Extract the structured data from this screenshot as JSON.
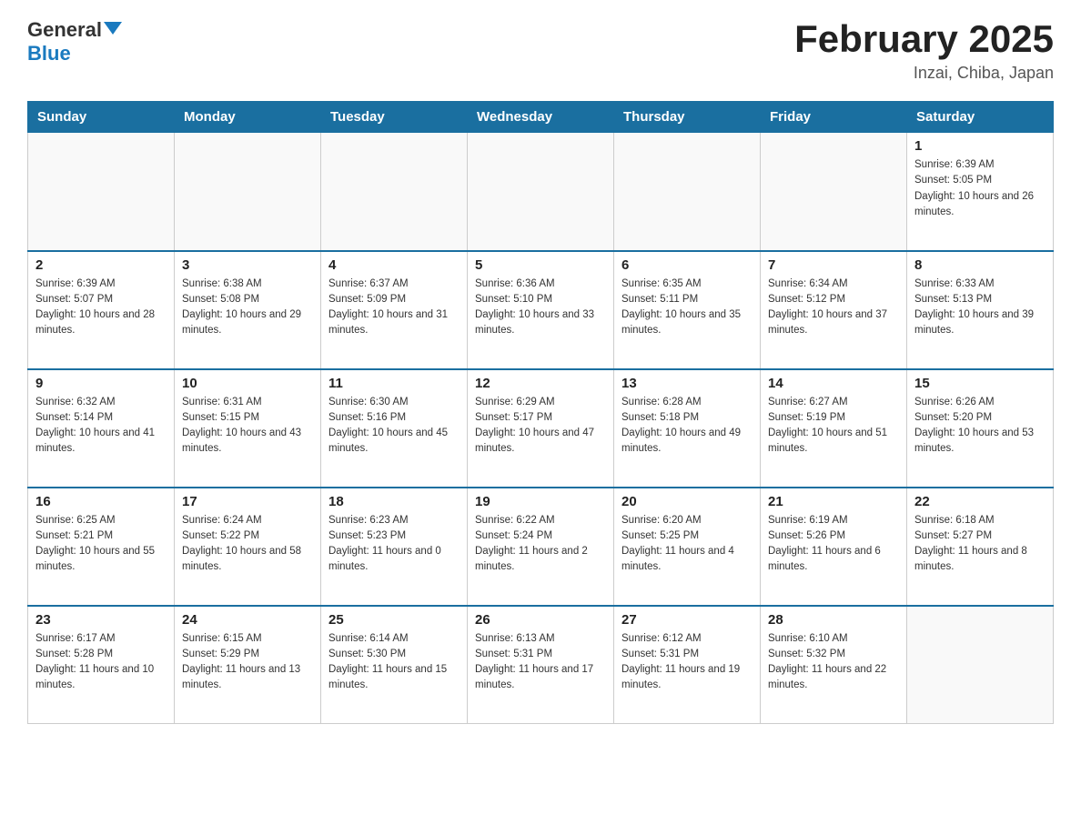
{
  "header": {
    "logo_general": "General",
    "logo_blue": "Blue",
    "title": "February 2025",
    "subtitle": "Inzai, Chiba, Japan"
  },
  "days_of_week": [
    "Sunday",
    "Monday",
    "Tuesday",
    "Wednesday",
    "Thursday",
    "Friday",
    "Saturday"
  ],
  "weeks": [
    [
      {
        "day": "",
        "info": ""
      },
      {
        "day": "",
        "info": ""
      },
      {
        "day": "",
        "info": ""
      },
      {
        "day": "",
        "info": ""
      },
      {
        "day": "",
        "info": ""
      },
      {
        "day": "",
        "info": ""
      },
      {
        "day": "1",
        "info": "Sunrise: 6:39 AM\nSunset: 5:05 PM\nDaylight: 10 hours and 26 minutes."
      }
    ],
    [
      {
        "day": "2",
        "info": "Sunrise: 6:39 AM\nSunset: 5:07 PM\nDaylight: 10 hours and 28 minutes."
      },
      {
        "day": "3",
        "info": "Sunrise: 6:38 AM\nSunset: 5:08 PM\nDaylight: 10 hours and 29 minutes."
      },
      {
        "day": "4",
        "info": "Sunrise: 6:37 AM\nSunset: 5:09 PM\nDaylight: 10 hours and 31 minutes."
      },
      {
        "day": "5",
        "info": "Sunrise: 6:36 AM\nSunset: 5:10 PM\nDaylight: 10 hours and 33 minutes."
      },
      {
        "day": "6",
        "info": "Sunrise: 6:35 AM\nSunset: 5:11 PM\nDaylight: 10 hours and 35 minutes."
      },
      {
        "day": "7",
        "info": "Sunrise: 6:34 AM\nSunset: 5:12 PM\nDaylight: 10 hours and 37 minutes."
      },
      {
        "day": "8",
        "info": "Sunrise: 6:33 AM\nSunset: 5:13 PM\nDaylight: 10 hours and 39 minutes."
      }
    ],
    [
      {
        "day": "9",
        "info": "Sunrise: 6:32 AM\nSunset: 5:14 PM\nDaylight: 10 hours and 41 minutes."
      },
      {
        "day": "10",
        "info": "Sunrise: 6:31 AM\nSunset: 5:15 PM\nDaylight: 10 hours and 43 minutes."
      },
      {
        "day": "11",
        "info": "Sunrise: 6:30 AM\nSunset: 5:16 PM\nDaylight: 10 hours and 45 minutes."
      },
      {
        "day": "12",
        "info": "Sunrise: 6:29 AM\nSunset: 5:17 PM\nDaylight: 10 hours and 47 minutes."
      },
      {
        "day": "13",
        "info": "Sunrise: 6:28 AM\nSunset: 5:18 PM\nDaylight: 10 hours and 49 minutes."
      },
      {
        "day": "14",
        "info": "Sunrise: 6:27 AM\nSunset: 5:19 PM\nDaylight: 10 hours and 51 minutes."
      },
      {
        "day": "15",
        "info": "Sunrise: 6:26 AM\nSunset: 5:20 PM\nDaylight: 10 hours and 53 minutes."
      }
    ],
    [
      {
        "day": "16",
        "info": "Sunrise: 6:25 AM\nSunset: 5:21 PM\nDaylight: 10 hours and 55 minutes."
      },
      {
        "day": "17",
        "info": "Sunrise: 6:24 AM\nSunset: 5:22 PM\nDaylight: 10 hours and 58 minutes."
      },
      {
        "day": "18",
        "info": "Sunrise: 6:23 AM\nSunset: 5:23 PM\nDaylight: 11 hours and 0 minutes."
      },
      {
        "day": "19",
        "info": "Sunrise: 6:22 AM\nSunset: 5:24 PM\nDaylight: 11 hours and 2 minutes."
      },
      {
        "day": "20",
        "info": "Sunrise: 6:20 AM\nSunset: 5:25 PM\nDaylight: 11 hours and 4 minutes."
      },
      {
        "day": "21",
        "info": "Sunrise: 6:19 AM\nSunset: 5:26 PM\nDaylight: 11 hours and 6 minutes."
      },
      {
        "day": "22",
        "info": "Sunrise: 6:18 AM\nSunset: 5:27 PM\nDaylight: 11 hours and 8 minutes."
      }
    ],
    [
      {
        "day": "23",
        "info": "Sunrise: 6:17 AM\nSunset: 5:28 PM\nDaylight: 11 hours and 10 minutes."
      },
      {
        "day": "24",
        "info": "Sunrise: 6:15 AM\nSunset: 5:29 PM\nDaylight: 11 hours and 13 minutes."
      },
      {
        "day": "25",
        "info": "Sunrise: 6:14 AM\nSunset: 5:30 PM\nDaylight: 11 hours and 15 minutes."
      },
      {
        "day": "26",
        "info": "Sunrise: 6:13 AM\nSunset: 5:31 PM\nDaylight: 11 hours and 17 minutes."
      },
      {
        "day": "27",
        "info": "Sunrise: 6:12 AM\nSunset: 5:31 PM\nDaylight: 11 hours and 19 minutes."
      },
      {
        "day": "28",
        "info": "Sunrise: 6:10 AM\nSunset: 5:32 PM\nDaylight: 11 hours and 22 minutes."
      },
      {
        "day": "",
        "info": ""
      }
    ]
  ]
}
